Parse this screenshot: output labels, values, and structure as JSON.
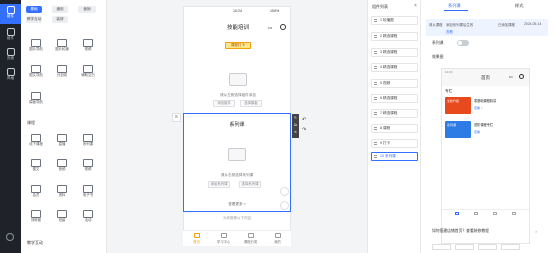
{
  "nav": {
    "items": [
      {
        "label": "组件",
        "icon": "component-icon",
        "active": true
      },
      {
        "label": "组件",
        "icon": "gear-icon",
        "active": false
      },
      {
        "label": "页面",
        "icon": "page-icon",
        "active": false
      },
      {
        "label": "风格",
        "icon": "brush-icon",
        "active": false
      }
    ]
  },
  "library": {
    "tabs": [
      "基础",
      "通用",
      "营销",
      "教学互动",
      "基础",
      "装修"
    ],
    "sections": [
      {
        "title": "课程"
      },
      {
        "title": "教学互动"
      }
    ],
    "tiles": [
      {
        "label": "图片导航"
      },
      {
        "label": "图片轮播"
      },
      {
        "label": "视频"
      },
      {
        "label": "图文导航"
      },
      {
        "label": "分割线"
      },
      {
        "label": "辅助空白"
      },
      {
        "label": "模板导航"
      },
      {
        "label": "线下课程"
      },
      {
        "label": "直播"
      },
      {
        "label": "系列课"
      },
      {
        "label": "图文"
      },
      {
        "label": "音频"
      },
      {
        "label": "视频"
      },
      {
        "label": "会员"
      },
      {
        "label": "资料"
      },
      {
        "label": "电子书"
      },
      {
        "label": "训练营"
      },
      {
        "label": "班级"
      },
      {
        "label": "活动"
      },
      {
        "label": "考试"
      },
      {
        "label": "题库"
      },
      {
        "label": "问答"
      }
    ]
  },
  "phone": {
    "time": "10:24",
    "battery": "100%",
    "title": "技能培训",
    "badge": "课程打卡",
    "empty_text_1": "请从左侧选择组件添加",
    "btn_a": "添加组件",
    "btn_b": "选择模板",
    "selected_title": "系列课",
    "empty_text_2": "请从右侧选择系列课",
    "btn_c": "添加系列课",
    "btn_d": "选择系列课",
    "view_more": "查看更多 >",
    "tip": "为你推荐以下内容",
    "tabs": [
      "首页",
      "学习中心",
      "课程分类",
      "我的"
    ]
  },
  "components": {
    "title": "组件列表",
    "items": [
      "1 轮播图",
      "2 精选课程",
      "3 精选课程",
      "4 精选课程",
      "5 视频",
      "6 精选课程",
      "7 精选课程",
      "8 课程",
      "9 打卡",
      "10 系列课"
    ],
    "active_index": 9
  },
  "settings": {
    "tab_active": "系列课",
    "tab_other": "样式",
    "info_1": "请从课程",
    "info_2": "添加系列课后生效",
    "info_3": "已添加课程",
    "info_4": "2024-05-14",
    "info_link": "查看",
    "label_style": "系列课",
    "label_preview": "效果图",
    "preview": {
      "status": "10:24",
      "title": "首页",
      "section": "专栏",
      "card1_thumb": "全新升级",
      "card1_title": "零基础课程精讲",
      "card1_meta": "查看 >",
      "card2_thumb": "系列课",
      "card2_title": "进阶课程专栏",
      "card2_meta": "查看"
    },
    "footer_question": "如何搭建店铺首页？查看装修教程",
    "footer_close": "×"
  }
}
